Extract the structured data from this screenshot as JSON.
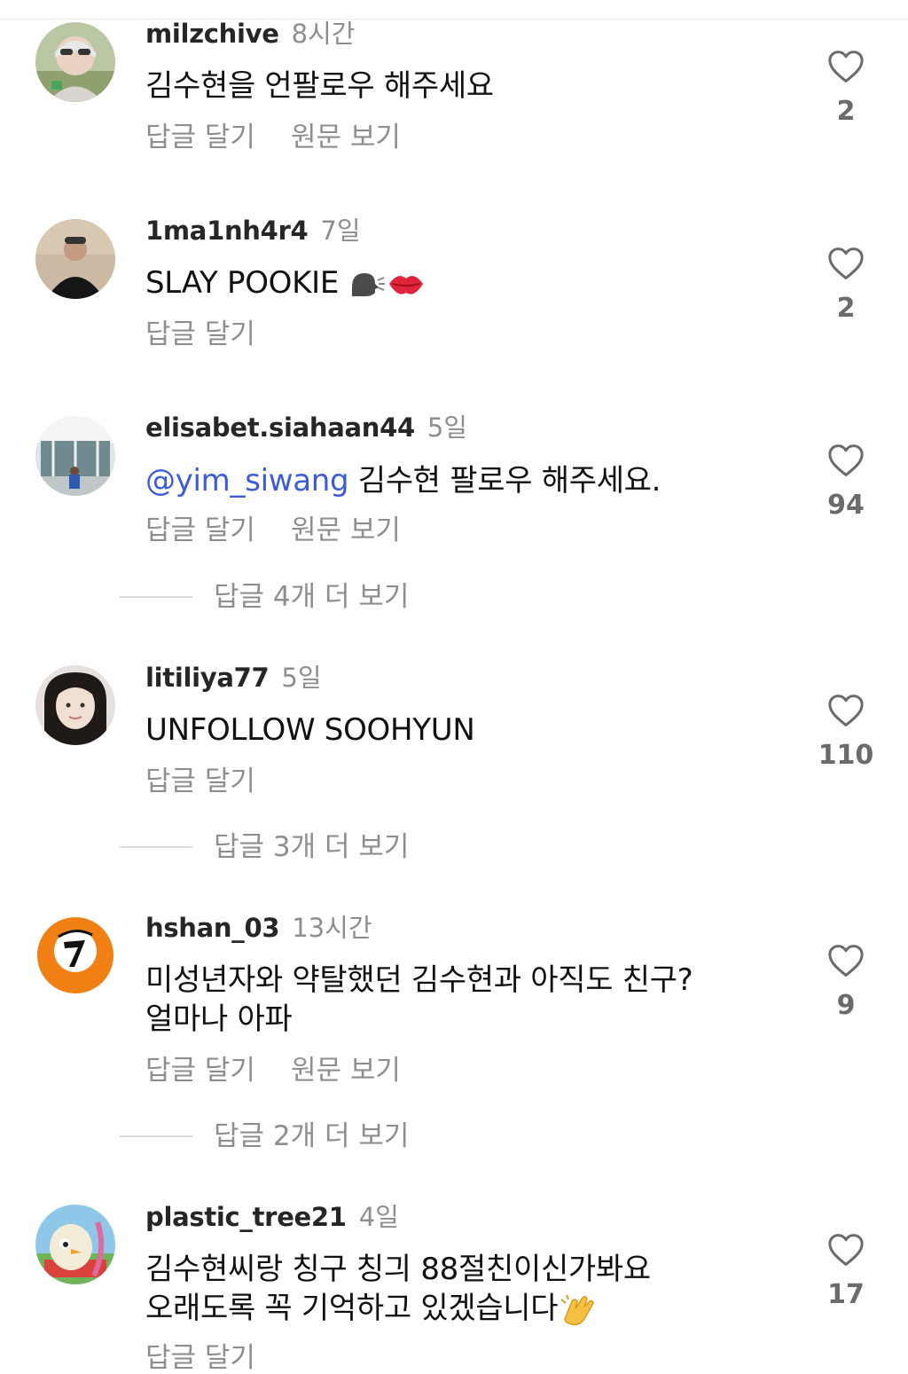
{
  "actions": {
    "reply": "답글 달기",
    "see_original": "원문 보기"
  },
  "comments": [
    {
      "username": "milzchive",
      "time": "8시간",
      "text": "김수현을 언팔로우 해주세요",
      "likes": "2"
    },
    {
      "username": "1ma1nh4r4",
      "time": "7일",
      "text": "SLAY POOKIE",
      "likes": "2"
    },
    {
      "username": "elisabet.siahaan44",
      "time": "5일",
      "mention": "@yim_siwang",
      "text": " 김수현 팔로우 해주세요.",
      "likes": "94",
      "more_replies": "답글 4개 더 보기"
    },
    {
      "username": "litiliya77",
      "time": "5일",
      "text": "UNFOLLOW SOOHYUN",
      "likes": "110",
      "more_replies": "답글 3개 더 보기"
    },
    {
      "username": "hshan_03",
      "time": "13시간",
      "text_line1": "미성년자와 약탈했던 김수현과 아직도 친구?",
      "text_line2": "얼마나 아파",
      "likes": "9",
      "more_replies": "답글 2개 더 보기"
    },
    {
      "username": "plastic_tree21",
      "time": "4일",
      "text_line1": "김수현씨랑 칭구 칭긔 88절친이신가봐요",
      "text_line2": "오래도록 꼭 기억하고 있겠습니다",
      "likes": "17"
    }
  ],
  "icons": {
    "like": "heart-outline-icon",
    "emoji_speaking": "speaking-head-icon",
    "emoji_kiss": "kiss-mark-icon",
    "emoji_clap": "clapping-hands-icon"
  },
  "colors": {
    "mention": "#3b5bdb",
    "secondary_text": "#8e8e8e"
  }
}
